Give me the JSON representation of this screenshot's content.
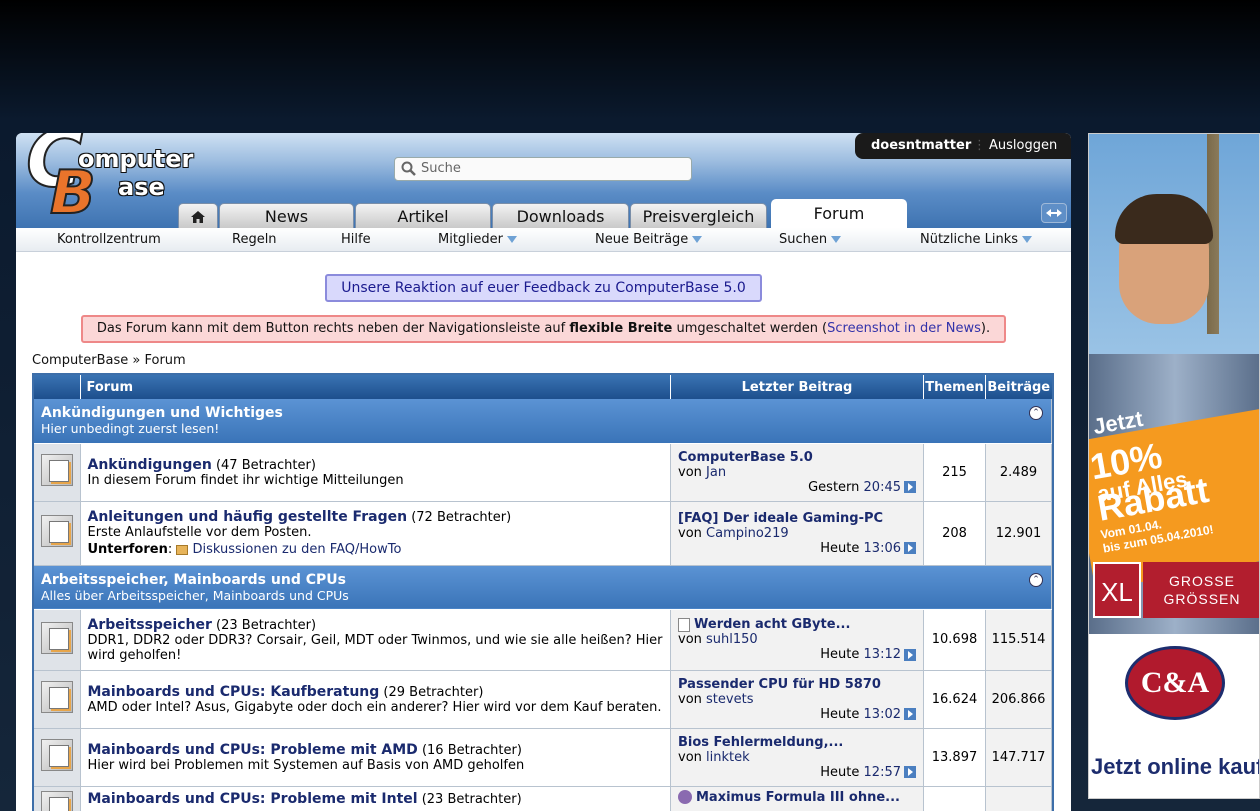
{
  "header": {
    "search_placeholder": "Suche",
    "username": "doesntmatter",
    "logout": "Ausloggen",
    "logo_top": "omputer",
    "logo_bottom": "ase"
  },
  "tabs": [
    "News",
    "Artikel",
    "Downloads",
    "Preisvergleich",
    "Forum"
  ],
  "subnav": [
    "Kontrollzentrum",
    "Regeln",
    "Hilfe",
    "Mitglieder",
    "Neue Beiträge",
    "Suchen",
    "Nützliche Links"
  ],
  "feedback_link": "Unsere Reaktion auf euer Feedback zu ComputerBase 5.0",
  "notice": {
    "pre": "Das Forum kann mit dem Button rechts neben der Navigationsleiste auf ",
    "bold": "flexible Breite",
    "mid": " umgeschaltet werden (",
    "link": "Screenshot in der News",
    "post": ")."
  },
  "breadcrumb": "ComputerBase » Forum",
  "table": {
    "headers": [
      "Forum",
      "Letzter Beitrag",
      "Themen",
      "Beiträge"
    ],
    "categories": [
      {
        "title": "Ankündigungen und Wichtiges",
        "subtitle": "Hier unbedingt zuerst lesen!"
      },
      {
        "title": "Arbeitsspeicher, Mainboards und CPUs",
        "subtitle": "Alles über Arbeitsspeicher, Mainboards und CPUs"
      }
    ],
    "rows": [
      {
        "name": "Ankündigungen",
        "viewers": "(47 Betrachter)",
        "desc": "In diesem Forum findet ihr wichtige Mitteilungen",
        "lp_title": "ComputerBase 5.0",
        "lp_by": "von",
        "lp_user": "Jan",
        "lp_day": "Gestern",
        "lp_time": "20:45",
        "threads": "215",
        "posts": "2.489"
      },
      {
        "name": "Anleitungen und häufig gestellte Fragen",
        "viewers": "(72 Betrachter)",
        "desc": "Erste Anlaufstelle vor dem Posten.",
        "sub_label": "Unterforen",
        "sub_link": "Diskussionen zu den FAQ/HowTo",
        "lp_title": "[FAQ] Der ideale Gaming-PC",
        "lp_by": "von",
        "lp_user": "Campino219",
        "lp_day": "Heute",
        "lp_time": "13:06",
        "threads": "208",
        "posts": "12.901"
      },
      {
        "name": "Arbeitsspeicher",
        "viewers": "(23 Betrachter)",
        "desc": "DDR1, DDR2 oder DDR3? Corsair, Geil, MDT oder Twinmos, und wie sie alle heißen? Hier wird geholfen!",
        "lp_title": "Werden acht GByte...",
        "lp_by": "von",
        "lp_user": "suhl150",
        "lp_day": "Heute",
        "lp_time": "13:12",
        "threads": "10.698",
        "posts": "115.514"
      },
      {
        "name": "Mainboards und CPUs: Kaufberatung",
        "viewers": "(29 Betrachter)",
        "desc": "AMD oder Intel? Asus, Gigabyte oder doch ein anderer? Hier wird vor dem Kauf beraten.",
        "lp_title": "Passender CPU für HD 5870",
        "lp_by": "von",
        "lp_user": "stevets",
        "lp_day": "Heute",
        "lp_time": "13:02",
        "threads": "16.624",
        "posts": "206.866"
      },
      {
        "name": "Mainboards und CPUs: Probleme mit AMD",
        "viewers": "(16 Betrachter)",
        "desc": "Hier wird bei Problemen mit Systemen auf Basis von AMD geholfen",
        "lp_title": "Bios Fehlermeldung,...",
        "lp_by": "von",
        "lp_user": "linktek",
        "lp_day": "Heute",
        "lp_time": "12:57",
        "threads": "13.897",
        "posts": "147.717"
      },
      {
        "name": "Mainboards und CPUs: Probleme mit Intel",
        "viewers": "(23 Betrachter)",
        "lp_title": "Maximus Formula III ohne..."
      }
    ]
  },
  "ad": {
    "line1": "Jetzt",
    "line2": "10% Rabatt",
    "line3": "auf Alles",
    "dates": "Vom 01.04.\nbis zum 05.04.2010!",
    "xl": "XL",
    "size": "GROSSE\nGRÖSSEN",
    "brand": "C&A",
    "cta": "Jetzt online kaufen"
  }
}
